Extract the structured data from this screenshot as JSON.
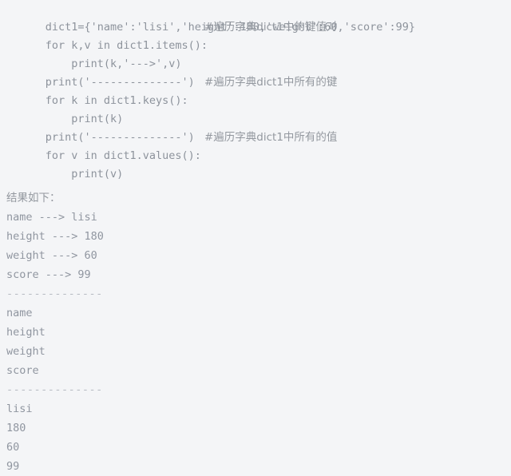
{
  "window": {
    "background_color": "#f4f5f7",
    "text_color": "#8d939c",
    "comment_color": "#93989f"
  },
  "code": {
    "language": "python",
    "lines": [
      {
        "src": "dict1={'name':'lisi','height':180,'weight':60,'score':99}",
        "comment": ""
      },
      {
        "src": "for k,v in dict1.items():",
        "comment": "#遍历字典dict1中的键值对"
      },
      {
        "src": "    print(k,'--->',v)",
        "comment": ""
      },
      {
        "src": "print('--------------')",
        "comment": ""
      },
      {
        "src": "for k in dict1.keys():",
        "comment": "#遍历字典dict1中所有的键"
      },
      {
        "src": "    print(k)",
        "comment": ""
      },
      {
        "src": "print('--------------')",
        "comment": ""
      },
      {
        "src": "for v in dict1.values():",
        "comment": "#遍历字典dict1中所有的值"
      },
      {
        "src": "    print(v)",
        "comment": ""
      }
    ]
  },
  "output": {
    "heading": "结果如下：",
    "lines": [
      "name ---> lisi",
      "height ---> 180",
      "weight ---> 60",
      "score ---> 99",
      "--------------",
      "name",
      "height",
      "weight",
      "score",
      "--------------",
      "lisi",
      "180",
      "60",
      "99"
    ]
  }
}
